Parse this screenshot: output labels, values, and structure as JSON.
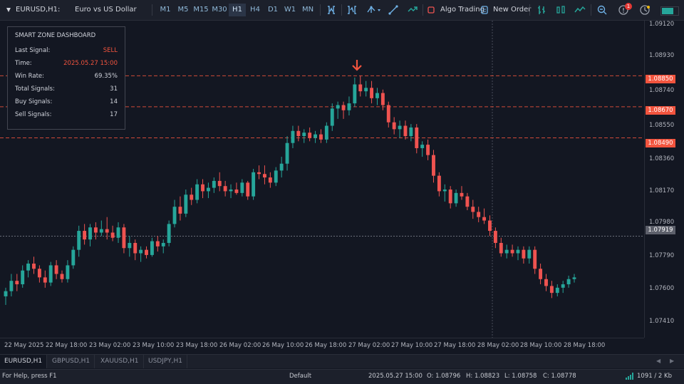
{
  "header": {
    "symbol": "EURUSD,H1:",
    "description": "Euro vs US Dollar"
  },
  "timeframes": [
    "M1",
    "M5",
    "M15",
    "M30",
    "H1",
    "H4",
    "D1",
    "W1",
    "MN"
  ],
  "active_timeframe": "H1",
  "toolbar": {
    "algo_trading": "Algo Trading",
    "new_order": "New Order",
    "alerts_badge": "1"
  },
  "dashboard": {
    "title": "SMART ZONE DASHBOARD",
    "rows": [
      {
        "label": "Last Signal:",
        "value": "SELL",
        "color": "#f2543e"
      },
      {
        "label": "Time:",
        "value": "2025.05.27 15:00",
        "color": "#f2543e"
      },
      {
        "label": "Win Rate:",
        "value": "69.35%",
        "color": "#d1d4dc"
      },
      {
        "label": "Total Signals:",
        "value": "31",
        "color": "#d1d4dc"
      },
      {
        "label": "Buy Signals:",
        "value": "14",
        "color": "#d1d4dc"
      },
      {
        "label": "Sell Signals:",
        "value": "17",
        "color": "#d1d4dc"
      }
    ]
  },
  "y_axis": {
    "labels": [
      "1.09120",
      "1.08930",
      "1.08740",
      "1.08550",
      "1.08360",
      "1.08170",
      "1.07980",
      "1.07790",
      "1.07600",
      "1.07410"
    ]
  },
  "levels": {
    "l1": {
      "price": "1.08850",
      "color": "#f2543e"
    },
    "l2": {
      "price": "1.08670",
      "color": "#f2543e"
    },
    "l3": {
      "price": "1.08490",
      "color": "#f2543e"
    },
    "current": {
      "price": "1.07919",
      "color": "#5d606b"
    }
  },
  "x_axis": {
    "labels": [
      "22 May 2025",
      "22 May 18:00",
      "23 May 02:00",
      "23 May 10:00",
      "23 May 18:00",
      "26 May 02:00",
      "26 May 10:00",
      "26 May 18:00",
      "27 May 02:00",
      "27 May 10:00",
      "27 May 18:00",
      "28 May 02:00",
      "28 May 10:00",
      "28 May 18:00"
    ]
  },
  "tabs": [
    "EURUSD,H1",
    "GBPUSD,H1",
    "XAUUSD,H1",
    "USDJPY,H1"
  ],
  "status": {
    "help": "For Help, press F1",
    "profile": "Default",
    "datetime": "2025.05.27 15:00",
    "open": "O: 1.08796",
    "high": "H: 1.08823",
    "low": "L: 1.08758",
    "close": "C: 1.08778",
    "traffic": "1091 / 2 Kb"
  },
  "colors": {
    "bull": "#26a69a",
    "bear": "#ef5350",
    "signal_arrow": "#f2543e"
  },
  "chart_data": {
    "type": "candlestick",
    "symbol": "EURUSD",
    "timeframe": "H1",
    "ylim": [
      1.0733,
      1.0917
    ],
    "candles": [
      [
        1.0757,
        1.0762,
        1.0752,
        1.076
      ],
      [
        1.076,
        1.077,
        1.0757,
        1.0766
      ],
      [
        1.0766,
        1.077,
        1.076,
        1.0764
      ],
      [
        1.0764,
        1.0775,
        1.0762,
        1.0772
      ],
      [
        1.0772,
        1.0778,
        1.0768,
        1.0776
      ],
      [
        1.0776,
        1.078,
        1.077,
        1.0773
      ],
      [
        1.0773,
        1.0775,
        1.0765,
        1.0768
      ],
      [
        1.0768,
        1.0772,
        1.0762,
        1.0765
      ],
      [
        1.0765,
        1.0777,
        1.0763,
        1.0775
      ],
      [
        1.0775,
        1.0778,
        1.0767,
        1.077
      ],
      [
        1.077,
        1.0772,
        1.0765,
        1.0767
      ],
      [
        1.0767,
        1.0778,
        1.0765,
        1.0775
      ],
      [
        1.0775,
        1.0786,
        1.0773,
        1.0784
      ],
      [
        1.0784,
        1.0798,
        1.078,
        1.0795
      ],
      [
        1.0795,
        1.0799,
        1.0787,
        1.079
      ],
      [
        1.079,
        1.0799,
        1.0786,
        1.0797
      ],
      [
        1.0797,
        1.08,
        1.079,
        1.0794
      ],
      [
        1.0794,
        1.0801,
        1.0792,
        1.0796
      ],
      [
        1.0796,
        1.0803,
        1.079,
        1.0794
      ],
      [
        1.0794,
        1.0798,
        1.0789,
        1.0791
      ],
      [
        1.0791,
        1.08,
        1.0788,
        1.0797
      ],
      [
        1.0797,
        1.0799,
        1.0782,
        1.0785
      ],
      [
        1.0785,
        1.0792,
        1.078,
        1.0788
      ],
      [
        1.0788,
        1.079,
        1.0778,
        1.0782
      ],
      [
        1.0782,
        1.0786,
        1.0777,
        1.0784
      ],
      [
        1.0784,
        1.0786,
        1.0779,
        1.0781
      ],
      [
        1.0781,
        1.0791,
        1.078,
        1.0789
      ],
      [
        1.0789,
        1.0792,
        1.0783,
        1.0786
      ],
      [
        1.0786,
        1.079,
        1.0782,
        1.0788
      ],
      [
        1.0788,
        1.0801,
        1.0786,
        1.0799
      ],
      [
        1.0799,
        1.0813,
        1.0797,
        1.0809
      ],
      [
        1.0809,
        1.0815,
        1.0801,
        1.0805
      ],
      [
        1.0805,
        1.0819,
        1.0803,
        1.0816
      ],
      [
        1.0816,
        1.082,
        1.081,
        1.0813
      ],
      [
        1.0813,
        1.0825,
        1.0811,
        1.0822
      ],
      [
        1.0822,
        1.0825,
        1.0814,
        1.0818
      ],
      [
        1.0818,
        1.0823,
        1.0814,
        1.082
      ],
      [
        1.082,
        1.0826,
        1.0817,
        1.0824
      ],
      [
        1.0824,
        1.0829,
        1.0818,
        1.0821
      ],
      [
        1.0821,
        1.0824,
        1.0815,
        1.0818
      ],
      [
        1.0818,
        1.0822,
        1.0814,
        1.0819
      ],
      [
        1.0819,
        1.0823,
        1.0816,
        1.0817
      ],
      [
        1.0817,
        1.0825,
        1.0815,
        1.0823
      ],
      [
        1.0823,
        1.0824,
        1.0813,
        1.0815
      ],
      [
        1.0815,
        1.0831,
        1.0813,
        1.0829
      ],
      [
        1.0829,
        1.0833,
        1.0825,
        1.0828
      ],
      [
        1.0828,
        1.0833,
        1.0822,
        1.0826
      ],
      [
        1.0826,
        1.0829,
        1.082,
        1.0823
      ],
      [
        1.0823,
        1.0832,
        1.0821,
        1.083
      ],
      [
        1.083,
        1.0838,
        1.0826,
        1.0834
      ],
      [
        1.0834,
        1.085,
        1.083,
        1.0846
      ],
      [
        1.0846,
        1.0856,
        1.0843,
        1.0853
      ],
      [
        1.0853,
        1.0856,
        1.0847,
        1.085
      ],
      [
        1.085,
        1.0854,
        1.0846,
        1.0852
      ],
      [
        1.0852,
        1.0855,
        1.0847,
        1.0849
      ],
      [
        1.0849,
        1.0853,
        1.0846,
        1.0851
      ],
      [
        1.0851,
        1.0854,
        1.0846,
        1.0848
      ],
      [
        1.0848,
        1.0858,
        1.0846,
        1.0856
      ],
      [
        1.0856,
        1.0869,
        1.0853,
        1.0866
      ],
      [
        1.0866,
        1.087,
        1.086,
        1.0868
      ],
      [
        1.0868,
        1.087,
        1.086,
        1.0865
      ],
      [
        1.0865,
        1.0873,
        1.0862,
        1.0869
      ],
      [
        1.0869,
        1.0884,
        1.0867,
        1.088
      ],
      [
        1.088,
        1.0885,
        1.0873,
        1.0876
      ],
      [
        1.0876,
        1.0882,
        1.0873,
        1.0878
      ],
      [
        1.0878,
        1.0882,
        1.0869,
        1.0872
      ],
      [
        1.0872,
        1.0878,
        1.0868,
        1.0875
      ],
      [
        1.0875,
        1.0877,
        1.0865,
        1.0868
      ],
      [
        1.0868,
        1.087,
        1.0855,
        1.0858
      ],
      [
        1.0858,
        1.0861,
        1.0851,
        1.0854
      ],
      [
        1.0854,
        1.0859,
        1.0849,
        1.0856
      ],
      [
        1.0856,
        1.0859,
        1.0848,
        1.085
      ],
      [
        1.085,
        1.0857,
        1.0847,
        1.0855
      ],
      [
        1.0855,
        1.0857,
        1.084,
        1.0843
      ],
      [
        1.0843,
        1.0847,
        1.0838,
        1.0845
      ],
      [
        1.0845,
        1.0848,
        1.0836,
        1.0839
      ],
      [
        1.0839,
        1.0842,
        1.0823,
        1.0827
      ],
      [
        1.0827,
        1.0829,
        1.0815,
        1.0818
      ],
      [
        1.0818,
        1.0822,
        1.0812,
        1.0819
      ],
      [
        1.0819,
        1.0821,
        1.0808,
        1.0811
      ],
      [
        1.0811,
        1.0819,
        1.0809,
        1.0817
      ],
      [
        1.0817,
        1.0821,
        1.0813,
        1.0815
      ],
      [
        1.0815,
        1.0817,
        1.0807,
        1.0809
      ],
      [
        1.0809,
        1.0813,
        1.0802,
        1.0806
      ],
      [
        1.0806,
        1.0809,
        1.08,
        1.0803
      ],
      [
        1.0803,
        1.0808,
        1.0799,
        1.0801
      ],
      [
        1.0801,
        1.0804,
        1.0792,
        1.0795
      ],
      [
        1.0795,
        1.0797,
        1.0785,
        1.0788
      ],
      [
        1.0788,
        1.0791,
        1.078,
        1.0782
      ],
      [
        1.0782,
        1.0787,
        1.0779,
        1.0784
      ],
      [
        1.0784,
        1.0787,
        1.078,
        1.0782
      ],
      [
        1.0782,
        1.0786,
        1.0778,
        1.0784
      ],
      [
        1.0784,
        1.0786,
        1.0776,
        1.0779
      ],
      [
        1.0779,
        1.0786,
        1.0776,
        1.0784
      ],
      [
        1.0784,
        1.0786,
        1.077,
        1.0773
      ],
      [
        1.0773,
        1.0776,
        1.0764,
        1.0767
      ],
      [
        1.0767,
        1.077,
        1.076,
        1.0763
      ],
      [
        1.0763,
        1.0766,
        1.0756,
        1.0759
      ],
      [
        1.0759,
        1.0764,
        1.0757,
        1.0762
      ],
      [
        1.0762,
        1.0766,
        1.0759,
        1.0764
      ],
      [
        1.0764,
        1.0769,
        1.0762,
        1.0767
      ],
      [
        1.0767,
        1.077,
        1.0765,
        1.0768
      ]
    ]
  }
}
